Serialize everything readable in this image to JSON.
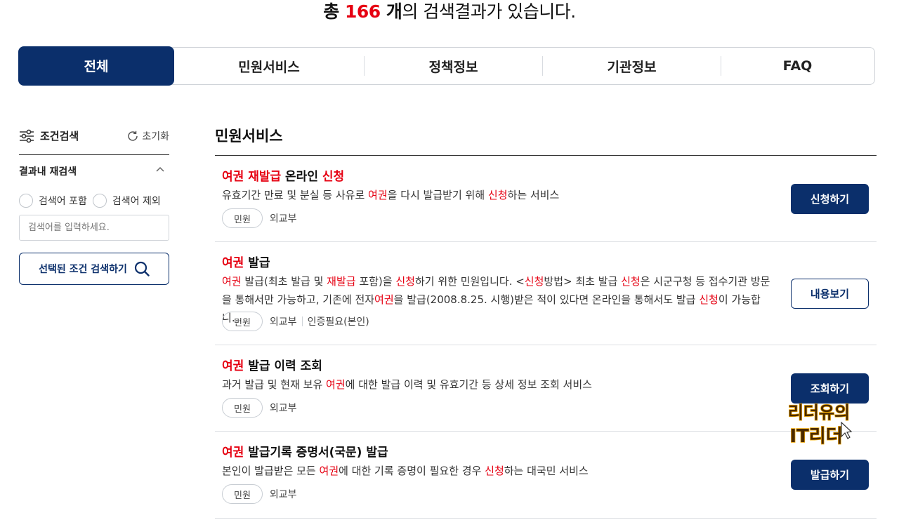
{
  "summary": {
    "prefix": "총 ",
    "count": "166",
    "unit": " 개",
    "suffix": "의 검색결과가 있습니다."
  },
  "tabs": [
    {
      "label": "전체",
      "active": true
    },
    {
      "label": "민원서비스"
    },
    {
      "label": "정책정보"
    },
    {
      "label": "기관정보"
    },
    {
      "label": "FAQ"
    }
  ],
  "sidebar": {
    "title": "조건검색",
    "reset_label": "초기화",
    "refine_label": "결과내 재검색",
    "include_label": "검색어 포함",
    "exclude_label": "검색어 제외",
    "input_placeholder": "검색어를 입력하세요.",
    "search_button": "선택된 조건 검색하기"
  },
  "section": {
    "title": "민원서비스"
  },
  "results": [
    {
      "title_hl": "여권 재발급",
      "title_mid": " 온라인 ",
      "title_hl2": "신청",
      "desc_1": "유효기간 만료 및 분실 등 사유로 ",
      "desc_hl1": "여권",
      "desc_2": "을 다시 발급받기 위해 ",
      "desc_hl2": "신청",
      "desc_3": "하는 서비스",
      "chip": "민원",
      "agency": "외교부",
      "button": "신청하기"
    },
    {
      "title_hl": "여권",
      "title_rest": " 발급",
      "desc_parts": [
        {
          "t": "여권",
          "hl": true
        },
        {
          "t": " 발급(최초 발급 및 "
        },
        {
          "t": "재발급",
          "hl": true
        },
        {
          "t": " 포함)을 "
        },
        {
          "t": "신청",
          "hl": true
        },
        {
          "t": "하기 위한 민원입니다. <"
        },
        {
          "t": "신청",
          "hl": true
        },
        {
          "t": "방법> 최초 발급 "
        },
        {
          "t": "신청",
          "hl": true
        },
        {
          "t": "은 시군구청 등 접수기관 방문을 통해서만 가능하고, 기존에 전자"
        },
        {
          "t": "여권",
          "hl": true
        },
        {
          "t": "을 발급(2008.8.25. 시행)받은 적이 있다면 온라인을 통해서도 발급 "
        },
        {
          "t": "신청",
          "hl": true
        },
        {
          "t": "이 가능합니…"
        }
      ],
      "chip": "민원",
      "agency": "외교부",
      "extra": "인증필요(본인)",
      "button": "내용보기"
    },
    {
      "title_hl": "여권",
      "title_rest": " 발급 이력 조회",
      "desc_1": "과거 발급 및 현재 보유 ",
      "desc_hl1": "여권",
      "desc_2": "에 대한 발급 이력 및 유효기간 등 상세 정보 조회 서비스",
      "chip": "민원",
      "agency": "외교부",
      "button": "조회하기"
    },
    {
      "title_hl": "여권",
      "title_rest": " 발급기록 증명서(국문) 발급",
      "desc_1": "본인이 발급받은 모든 ",
      "desc_hl1": "여권",
      "desc_2": "에 대한 기록 증명이 필요한 경우 ",
      "desc_hl2": "신청",
      "desc_3": "하는 대국민 서비스",
      "chip": "민원",
      "agency": "외교부",
      "button": "발급하기"
    }
  ],
  "watermark": {
    "line1": "리더유의",
    "line2": "IT리더"
  },
  "colors": {
    "primary": "#0b2f6b",
    "highlight": "#e60012"
  }
}
